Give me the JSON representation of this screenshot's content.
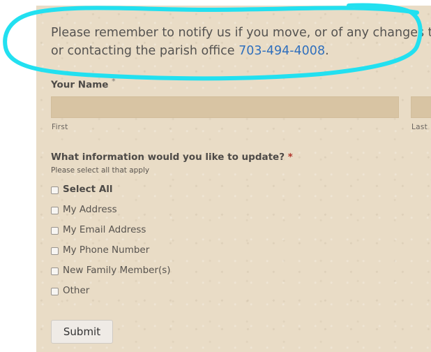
{
  "intro": {
    "line1": "Please remember to notify us if you move, or of any changes to",
    "line2_text": "or contacting the parish office ",
    "phone": "703-494-4008",
    "line2_end": "."
  },
  "name_field": {
    "label": "Your Name",
    "required_mark": "*",
    "first_label": "First",
    "last_label": "Last",
    "first_value": "",
    "last_value": ""
  },
  "update_question": {
    "label": "What information would you like to update?",
    "required_mark": "*",
    "description": "Please select all that apply",
    "options": [
      {
        "label": "Select All",
        "checked": false
      },
      {
        "label": "My Address",
        "checked": false
      },
      {
        "label": "My Email Address",
        "checked": false
      },
      {
        "label": "My Phone Number",
        "checked": false
      },
      {
        "label": "New Family Member(s)",
        "checked": false
      },
      {
        "label": "Other",
        "checked": false
      }
    ]
  },
  "submit_label": "Submit",
  "colors": {
    "background": "#e9dcc6",
    "input": "#d8c4a3",
    "link": "#2f6fbd",
    "required": "#b0342a",
    "annotation": "#22e0f0"
  }
}
